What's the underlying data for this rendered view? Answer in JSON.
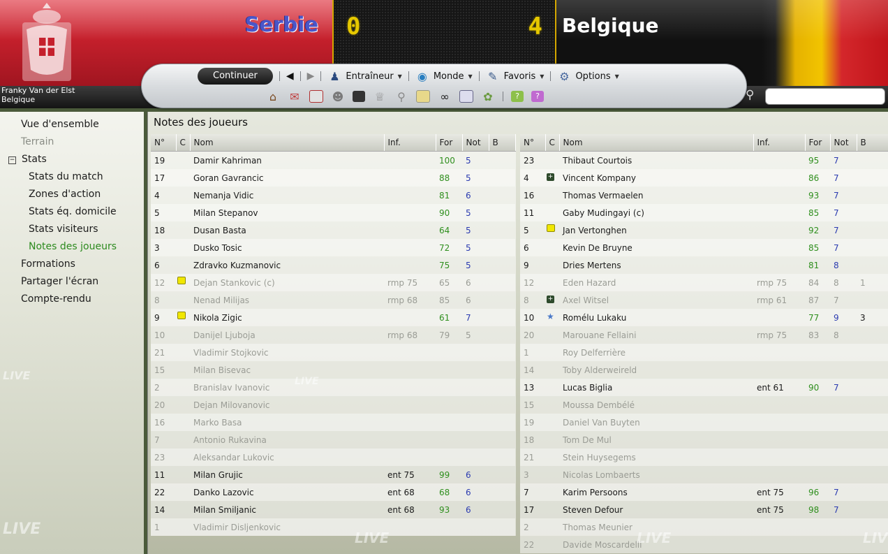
{
  "match": {
    "home_team": "Serbie",
    "away_team": "Belgique",
    "home_score": "0",
    "away_score": "4"
  },
  "manager": {
    "name": "Franky Van der Elst",
    "team": "Belgique"
  },
  "toolbar": {
    "continue": "Continuer",
    "coach": "Entraîneur",
    "world": "Monde",
    "favorites": "Favoris",
    "options": "Options"
  },
  "sidebar": {
    "items": [
      {
        "label": "Vue d'ensemble",
        "level": 1
      },
      {
        "label": "Terrain",
        "level": 1,
        "disabled": true
      },
      {
        "label": "Stats",
        "level": 0,
        "group": true
      },
      {
        "label": "Stats du match",
        "level": 2
      },
      {
        "label": "Zones d'action",
        "level": 2
      },
      {
        "label": "Stats éq. domicile",
        "level": 2
      },
      {
        "label": "Stats visiteurs",
        "level": 2
      },
      {
        "label": "Notes des joueurs",
        "level": 2,
        "active": true
      },
      {
        "label": "Formations",
        "level": 1
      },
      {
        "label": "Partager l'écran",
        "level": 1
      },
      {
        "label": "Compte-rendu",
        "level": 1
      }
    ],
    "watermark": "LIVE"
  },
  "main": {
    "title": "Notes des joueurs",
    "columns": [
      "N°",
      "C",
      "Nom",
      "Inf.",
      "For",
      "Not",
      "B"
    ],
    "home_players": [
      {
        "no": "19",
        "c": "",
        "name": "Damir Kahriman",
        "inf": "",
        "for": "100",
        "not": "5",
        "b": "",
        "played": true
      },
      {
        "no": "17",
        "c": "",
        "name": "Goran Gavrancic",
        "inf": "",
        "for": "88",
        "not": "5",
        "b": "",
        "played": true
      },
      {
        "no": "4",
        "c": "",
        "name": "Nemanja Vidic",
        "inf": "",
        "for": "81",
        "not": "6",
        "b": "",
        "played": true
      },
      {
        "no": "5",
        "c": "",
        "name": "Milan Stepanov",
        "inf": "",
        "for": "90",
        "not": "5",
        "b": "",
        "played": true
      },
      {
        "no": "18",
        "c": "",
        "name": "Dusan Basta",
        "inf": "",
        "for": "64",
        "not": "5",
        "b": "",
        "played": true
      },
      {
        "no": "3",
        "c": "",
        "name": "Dusko Tosic",
        "inf": "",
        "for": "72",
        "not": "5",
        "b": "",
        "played": true
      },
      {
        "no": "6",
        "c": "",
        "name": "Zdravko Kuzmanovic",
        "inf": "",
        "for": "75",
        "not": "5",
        "b": "",
        "played": true
      },
      {
        "no": "12",
        "c": "yellow",
        "name": "Dejan Stankovic (c)",
        "inf": "rmp 75",
        "for": "65",
        "not": "6",
        "b": "",
        "played": false
      },
      {
        "no": "8",
        "c": "",
        "name": "Nenad Milijas",
        "inf": "rmp 68",
        "for": "85",
        "not": "6",
        "b": "",
        "played": false
      },
      {
        "no": "9",
        "c": "yellow",
        "name": "Nikola Zigic",
        "inf": "",
        "for": "61",
        "not": "7",
        "b": "",
        "played": true
      },
      {
        "no": "10",
        "c": "",
        "name": "Danijel Ljuboja",
        "inf": "rmp 68",
        "for": "79",
        "not": "5",
        "b": "",
        "played": false
      },
      {
        "no": "21",
        "c": "",
        "name": "Vladimir Stojkovic",
        "inf": "",
        "for": "",
        "not": "",
        "b": "",
        "played": false
      },
      {
        "no": "15",
        "c": "",
        "name": "Milan Bisevac",
        "inf": "",
        "for": "",
        "not": "",
        "b": "",
        "played": false
      },
      {
        "no": "2",
        "c": "",
        "name": "Branislav Ivanovic",
        "inf": "",
        "for": "",
        "not": "",
        "b": "",
        "played": false
      },
      {
        "no": "20",
        "c": "",
        "name": "Dejan Milovanovic",
        "inf": "",
        "for": "",
        "not": "",
        "b": "",
        "played": false
      },
      {
        "no": "16",
        "c": "",
        "name": "Marko Basa",
        "inf": "",
        "for": "",
        "not": "",
        "b": "",
        "played": false
      },
      {
        "no": "7",
        "c": "",
        "name": "Antonio Rukavina",
        "inf": "",
        "for": "",
        "not": "",
        "b": "",
        "played": false
      },
      {
        "no": "23",
        "c": "",
        "name": "Aleksandar Lukovic",
        "inf": "",
        "for": "",
        "not": "",
        "b": "",
        "played": false
      },
      {
        "no": "11",
        "c": "",
        "name": "Milan Grujic",
        "inf": "ent 75",
        "for": "99",
        "not": "6",
        "b": "",
        "played": true
      },
      {
        "no": "22",
        "c": "",
        "name": "Danko Lazovic",
        "inf": "ent 68",
        "for": "68",
        "not": "6",
        "b": "",
        "played": true
      },
      {
        "no": "14",
        "c": "",
        "name": "Milan Smiljanic",
        "inf": "ent 68",
        "for": "93",
        "not": "6",
        "b": "",
        "played": true
      },
      {
        "no": "1",
        "c": "",
        "name": "Vladimir Disljenkovic",
        "inf": "",
        "for": "",
        "not": "",
        "b": "",
        "played": false
      }
    ],
    "away_players": [
      {
        "no": "23",
        "c": "",
        "name": "Thibaut Courtois",
        "inf": "",
        "for": "95",
        "not": "7",
        "b": "",
        "played": true
      },
      {
        "no": "4",
        "c": "goal",
        "name": "Vincent Kompany",
        "inf": "",
        "for": "86",
        "not": "7",
        "b": "",
        "played": true
      },
      {
        "no": "16",
        "c": "",
        "name": "Thomas Vermaelen",
        "inf": "",
        "for": "93",
        "not": "7",
        "b": "",
        "played": true
      },
      {
        "no": "11",
        "c": "",
        "name": "Gaby Mudingayi (c)",
        "inf": "",
        "for": "85",
        "not": "7",
        "b": "",
        "played": true
      },
      {
        "no": "5",
        "c": "yellow",
        "name": "Jan Vertonghen",
        "inf": "",
        "for": "92",
        "not": "7",
        "b": "",
        "played": true
      },
      {
        "no": "6",
        "c": "",
        "name": "Kevin De Bruyne",
        "inf": "",
        "for": "85",
        "not": "7",
        "b": "",
        "played": true
      },
      {
        "no": "9",
        "c": "",
        "name": "Dries Mertens",
        "inf": "",
        "for": "81",
        "not": "8",
        "b": "",
        "played": true
      },
      {
        "no": "12",
        "c": "",
        "name": "Eden Hazard",
        "inf": "rmp 75",
        "for": "84",
        "not": "8",
        "b": "1",
        "played": false
      },
      {
        "no": "8",
        "c": "goal",
        "name": "Axel Witsel",
        "inf": "rmp 61",
        "for": "87",
        "not": "7",
        "b": "",
        "played": false
      },
      {
        "no": "10",
        "c": "star",
        "name": "Romélu Lukaku",
        "inf": "",
        "for": "77",
        "not": "9",
        "b": "3",
        "played": true
      },
      {
        "no": "20",
        "c": "",
        "name": "Marouane Fellaini",
        "inf": "rmp 75",
        "for": "83",
        "not": "8",
        "b": "",
        "played": false
      },
      {
        "no": "1",
        "c": "",
        "name": "Roy Delferrière",
        "inf": "",
        "for": "",
        "not": "",
        "b": "",
        "played": false
      },
      {
        "no": "14",
        "c": "",
        "name": "Toby Alderweireld",
        "inf": "",
        "for": "",
        "not": "",
        "b": "",
        "played": false
      },
      {
        "no": "13",
        "c": "",
        "name": "Lucas Biglia",
        "inf": "ent 61",
        "for": "90",
        "not": "7",
        "b": "",
        "played": true
      },
      {
        "no": "15",
        "c": "",
        "name": "Moussa Dembélé",
        "inf": "",
        "for": "",
        "not": "",
        "b": "",
        "played": false
      },
      {
        "no": "19",
        "c": "",
        "name": "Daniel Van Buyten",
        "inf": "",
        "for": "",
        "not": "",
        "b": "",
        "played": false
      },
      {
        "no": "18",
        "c": "",
        "name": "Tom De Mul",
        "inf": "",
        "for": "",
        "not": "",
        "b": "",
        "played": false
      },
      {
        "no": "21",
        "c": "",
        "name": "Stein Huysegems",
        "inf": "",
        "for": "",
        "not": "",
        "b": "",
        "played": false
      },
      {
        "no": "3",
        "c": "",
        "name": "Nicolas Lombaerts",
        "inf": "",
        "for": "",
        "not": "",
        "b": "",
        "played": false
      },
      {
        "no": "7",
        "c": "",
        "name": "Karim Persoons",
        "inf": "ent 75",
        "for": "96",
        "not": "7",
        "b": "",
        "played": true
      },
      {
        "no": "17",
        "c": "",
        "name": "Steven Defour",
        "inf": "ent 75",
        "for": "98",
        "not": "7",
        "b": "",
        "played": true
      },
      {
        "no": "2",
        "c": "",
        "name": "Thomas Meunier",
        "inf": "",
        "for": "",
        "not": "",
        "b": "",
        "played": false
      },
      {
        "no": "22",
        "c": "",
        "name": "Davide Moscardelli",
        "inf": "",
        "for": "",
        "not": "",
        "b": "",
        "played": false
      }
    ]
  },
  "colors": {
    "home_red": "#c5202c",
    "score_yellow": "#e6c800",
    "rating_green": "#2f8f1e",
    "note_blue": "#2b3bb0",
    "active_green": "#2d8b1f"
  }
}
